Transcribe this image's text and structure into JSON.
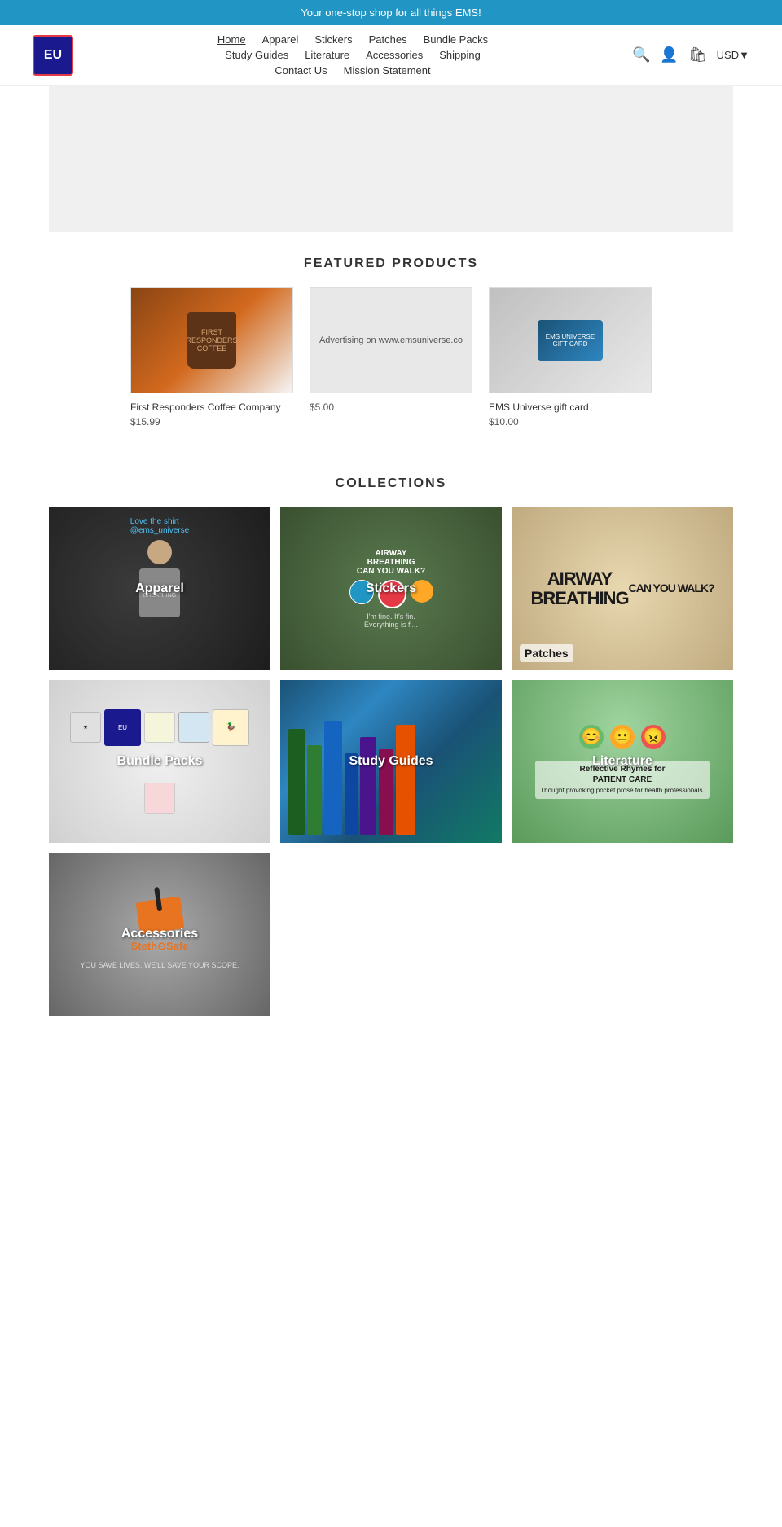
{
  "banner": {
    "text": "Your one-stop shop for all things EMS!"
  },
  "logo": {
    "text": "EU"
  },
  "nav": {
    "row1": [
      {
        "label": "Home",
        "active": true
      },
      {
        "label": "Apparel",
        "active": false
      },
      {
        "label": "Stickers",
        "active": false
      },
      {
        "label": "Patches",
        "active": false
      },
      {
        "label": "Bundle Packs",
        "active": false
      }
    ],
    "row2": [
      {
        "label": "Study Guides",
        "active": false
      },
      {
        "label": "Literature",
        "active": false
      },
      {
        "label": "Accessories",
        "active": false
      },
      {
        "label": "Shipping",
        "active": false
      }
    ],
    "row3": [
      {
        "label": "Contact Us",
        "active": false
      },
      {
        "label": "Mission Statement",
        "active": false
      }
    ]
  },
  "currency": "USD",
  "featured": {
    "section_title": "FEATURED PRODUCTS",
    "products": [
      {
        "title": "First Responders Coffee Company",
        "price": "$15.99"
      },
      {
        "title": "Advertising on www.emsuniverse.co",
        "price": "$5.00"
      },
      {
        "title": "EMS Universe gift card",
        "price": "$10.00"
      }
    ]
  },
  "collections": {
    "section_title": "COLLECTIONS",
    "items": [
      {
        "label": "Apparel",
        "type": "apparel"
      },
      {
        "label": "Stickers",
        "type": "stickers"
      },
      {
        "label": "Patches",
        "type": "patches"
      },
      {
        "label": "Bundle Packs",
        "type": "bundle"
      },
      {
        "label": "Study Guides",
        "type": "studyguides"
      },
      {
        "label": "Literature",
        "type": "literature"
      },
      {
        "label": "Accessories",
        "type": "accessories"
      }
    ]
  }
}
